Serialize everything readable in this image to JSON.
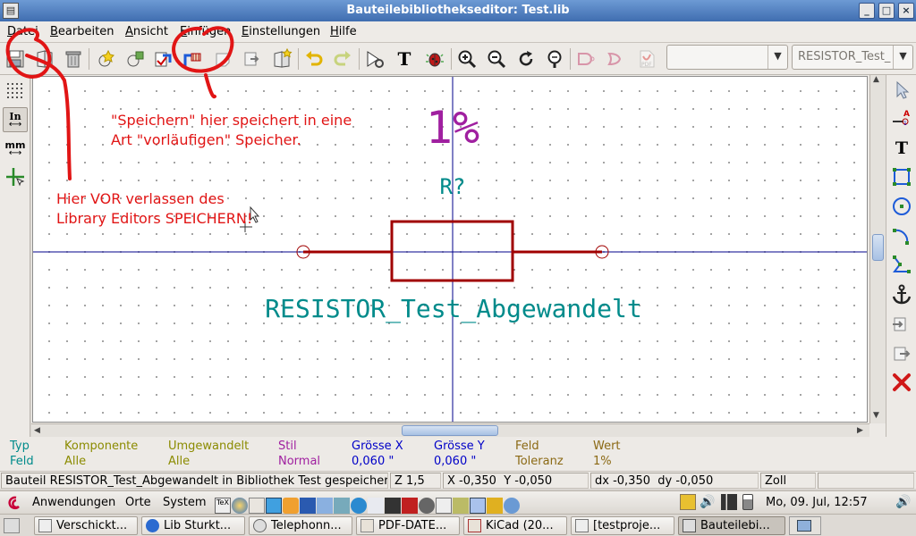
{
  "window": {
    "title": "Bauteilebibliothekseditor: Test.lib",
    "app_icon": "kicad-libedit-icon",
    "buttons": [
      "minimize",
      "maximize",
      "close"
    ]
  },
  "menubar": [
    {
      "label": "Datei",
      "mnemonic": "D"
    },
    {
      "label": "Bearbeiten",
      "mnemonic": "B"
    },
    {
      "label": "Ansicht",
      "mnemonic": "A"
    },
    {
      "label": "Einfügen",
      "mnemonic": "E"
    },
    {
      "label": "Einstellungen",
      "mnemonic": "E"
    },
    {
      "label": "Hilfe",
      "mnemonic": "H"
    }
  ],
  "toolbar": {
    "icons": [
      "save-library-icon",
      "select-library-icon",
      "delete-part-icon",
      "new-part-icon",
      "new-part-from-icon",
      "import-part-icon",
      "save-current-part-icon",
      "export-part-icon",
      "export-image-icon",
      "create-new-library-icon",
      "undo-icon",
      "redo-icon",
      "part-properties-icon",
      "text-tool-icon",
      "erc-bug-icon",
      "zoom-in-icon",
      "zoom-out-icon",
      "zoom-redraw-icon",
      "zoom-fit-icon",
      "show-convert-icon",
      "show-normal-icon",
      "datasheet-pdf-icon"
    ],
    "unit_select": "",
    "part_select": "RESISTOR_Test_"
  },
  "left_toolbar": {
    "grid_icon": "grid-icon",
    "units_in": "In",
    "units_mm": "mm",
    "cursor_icon": "full-cursor-icon"
  },
  "right_toolbar": [
    "select-arrow-icon",
    "add-pin-icon",
    "add-text-icon",
    "add-rectangle-icon",
    "add-circle-icon",
    "add-arc-icon",
    "add-polyline-icon",
    "anchor-icon",
    "import-graphic-icon",
    "export-graphic-icon",
    "delete-icon"
  ],
  "canvas": {
    "value_text": "1%",
    "reference_text": "R?",
    "name_text": "RESISTOR_Test_Abgewandelt",
    "colors": {
      "value": "#a020a0",
      "reference": "#008b8b",
      "body": "#a00000",
      "axis": "#00008b"
    }
  },
  "annotations": {
    "note1_line1": "\"Speichern\" hier speichert in eine",
    "note1_line2": "Art \"vorläufigen\" Speicher.",
    "note2_line1": "Hier VOR verlassen des",
    "note2_line2": "Library Editors SPEICHERN!",
    "color": "#e11515"
  },
  "properties": [
    {
      "header": "Typ",
      "value": "Feld",
      "hcolor": "#008b8b",
      "vcolor": "#008b8b"
    },
    {
      "header": "Komponente",
      "value": "Alle",
      "hcolor": "#8b8b00",
      "vcolor": "#8b8b00"
    },
    {
      "header": "Umgewandelt",
      "value": "Alle",
      "hcolor": "#8b8b00",
      "vcolor": "#8b8b00"
    },
    {
      "header": "Stil",
      "value": "Normal",
      "hcolor": "#a020a0",
      "vcolor": "#a020a0"
    },
    {
      "header": "Grösse X",
      "value": "0,060 \"",
      "hcolor": "#0000c8",
      "vcolor": "#0000c8"
    },
    {
      "header": "Grösse Y",
      "value": "0,060 \"",
      "hcolor": "#0000c8",
      "vcolor": "#0000c8"
    },
    {
      "header": "Feld",
      "value": "Toleranz",
      "hcolor": "#8b6914",
      "vcolor": "#8b6914"
    },
    {
      "header": "Wert",
      "value": "1%",
      "hcolor": "#8b6914",
      "vcolor": "#8b6914"
    }
  ],
  "status": {
    "message": "Bauteil RESISTOR_Test_Abgewandelt in Bibliothek Test gespeichert",
    "zoom": "Z 1,5",
    "abs_coords": "X -0,350  Y -0,050",
    "rel_coords": "dx -0,350  dy -0,050",
    "units": "Zoll"
  },
  "gnome_panel": {
    "menu_applications": "Anwendungen",
    "menu_places": "Orte",
    "menu_system": "System",
    "clock": "Mo, 09. Jul, 12:57"
  },
  "taskbar": [
    {
      "label": "Verschickt...",
      "icon": "mail-icon"
    },
    {
      "label": "Lib Sturkt...",
      "icon": "firefox-icon"
    },
    {
      "label": "Telephonn...",
      "icon": "phone-icon"
    },
    {
      "label": "PDF-DATE...",
      "icon": "pdf-folder-icon"
    },
    {
      "label": "KiCad (20...",
      "icon": "kicad-icon"
    },
    {
      "label": "[testproje...",
      "icon": "eeschema-icon"
    },
    {
      "label": "Bauteilebi...",
      "icon": "libedit-icon",
      "active": true
    }
  ]
}
